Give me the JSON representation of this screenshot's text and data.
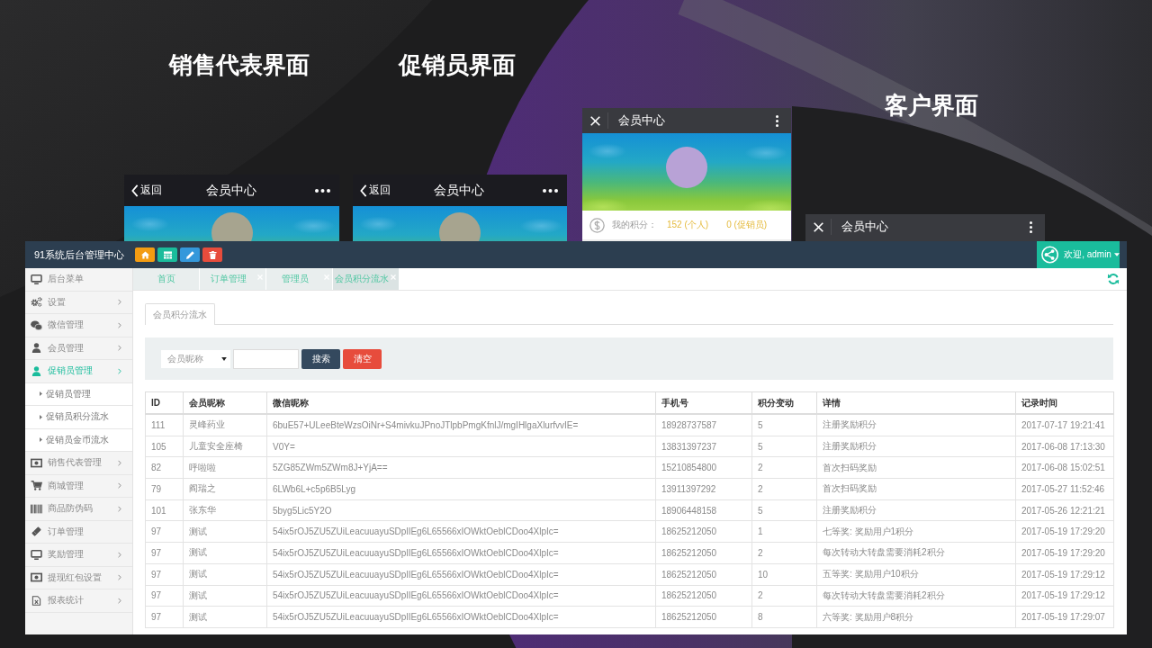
{
  "slide_headings": [
    "销售代表界面",
    "促销员界面",
    "客户界面"
  ],
  "phones": [
    {
      "kind": "ios",
      "back_label": "返回",
      "title": "会员中心",
      "banner": true
    },
    {
      "kind": "ios",
      "back_label": "返回",
      "title": "会员中心",
      "banner": true
    },
    {
      "kind": "android",
      "title": "会员中心",
      "banner": true,
      "points": {
        "label": "我的积分：",
        "personal": "152 (个人)",
        "promoter": "0 (促销员)"
      }
    },
    {
      "kind": "android",
      "title": "会员中心"
    }
  ],
  "admin": {
    "title": "91系统后台管理中心",
    "tool_buttons": [
      {
        "kind": "home"
      },
      {
        "kind": "grid"
      },
      {
        "kind": "edit"
      },
      {
        "kind": "delete"
      }
    ],
    "user_menu": "欢迎, admin",
    "sidebar": {
      "items": [
        {
          "label": "后台菜单",
          "selected": false,
          "chevron": false
        },
        {
          "label": "设置",
          "selected": false,
          "chevron": true
        },
        {
          "label": "微信管理",
          "selected": false,
          "chevron": true
        },
        {
          "label": "会员管理",
          "selected": false,
          "chevron": true
        },
        {
          "label": "促销员管理",
          "selected": true,
          "chevron": true,
          "children": [
            {
              "label": "促销员管理",
              "selected": false
            },
            {
              "label": "促销员积分流水",
              "selected": false
            },
            {
              "label": "促销员金币流水",
              "selected": false
            }
          ]
        },
        {
          "label": "销售代表管理",
          "selected": false,
          "chevron": true
        },
        {
          "label": "商城管理",
          "selected": false,
          "chevron": true
        },
        {
          "label": "商品防伪码",
          "selected": false,
          "chevron": true
        },
        {
          "label": "订单管理",
          "selected": false,
          "chevron": false
        },
        {
          "label": "奖励管理",
          "selected": false,
          "chevron": true
        },
        {
          "label": "提现红包设置",
          "selected": false,
          "chevron": true
        },
        {
          "label": "报表统计",
          "selected": false,
          "chevron": true
        }
      ]
    },
    "tabs": [
      {
        "label": "首页",
        "closable": false,
        "selected": false
      },
      {
        "label": "订单管理",
        "closable": true,
        "selected": false
      },
      {
        "label": "管理员",
        "closable": true,
        "selected": false
      },
      {
        "label": "会员积分流水",
        "closable": true,
        "selected": true
      }
    ],
    "panel_tabs": [
      {
        "label": "会员积分流水",
        "selected": true
      }
    ],
    "search": {
      "filter_field": "会员昵称",
      "buttons": [
        {
          "kind": "primary",
          "label": "搜索"
        },
        {
          "kind": "danger",
          "label": "清空"
        }
      ]
    },
    "table": {
      "columns": [
        "ID",
        "会员昵称",
        "微信昵称",
        "手机号",
        "积分变动",
        "详情",
        "记录时间"
      ],
      "rows": [
        [
          "111",
          "灵峰药业",
          "6buE57+ULeeBteWzsOiNr+S4mivkuJPnoJTlpbPmgKfnlJ/mgIHlgaXlurfvvIE=",
          "18928737587",
          "5",
          "注册奖励积分",
          "2017-07-17 19:21:41"
        ],
        [
          "105",
          "儿童安全座椅",
          "V0Y=",
          "13831397237",
          "5",
          "注册奖励积分",
          "2017-06-08 17:13:30"
        ],
        [
          "82",
          "呼啦啦",
          "5ZG85ZWm5ZWm8J+YjA==",
          "15210854800",
          "2",
          "首次扫码奖励",
          "2017-06-08 15:02:51"
        ],
        [
          "79",
          "阎瑞之",
          "6LWb6L+c5p6B5Lyg",
          "13911397292",
          "2",
          "首次扫码奖励",
          "2017-05-27 11:52:46"
        ],
        [
          "101",
          "张东华",
          "5byg5Lic5Y2O",
          "18906448158",
          "5",
          "注册奖励积分",
          "2017-05-26 12:21:21"
        ],
        [
          "97",
          "测试",
          "54ix5rOJ5ZU5ZUiLeacuuayuSDplIEg6L65566xIOWktOeblCDoo4XlpIc=",
          "18625212050",
          "1",
          "七等奖: 奖励用户1积分",
          "2017-05-19 17:29:20"
        ],
        [
          "97",
          "测试",
          "54ix5rOJ5ZU5ZUiLeacuuayuSDplIEg6L65566xIOWktOeblCDoo4XlpIc=",
          "18625212050",
          "2",
          "每次转动大转盘需要消耗2积分",
          "2017-05-19 17:29:20"
        ],
        [
          "97",
          "测试",
          "54ix5rOJ5ZU5ZUiLeacuuayuSDplIEg6L65566xIOWktOeblCDoo4XlpIc=",
          "18625212050",
          "10",
          "五等奖: 奖励用户10积分",
          "2017-05-19 17:29:12"
        ],
        [
          "97",
          "测试",
          "54ix5rOJ5ZU5ZUiLeacuuayuSDplIEg6L65566xIOWktOeblCDoo4XlpIc=",
          "18625212050",
          "2",
          "每次转动大转盘需要消耗2积分",
          "2017-05-19 17:29:12"
        ],
        [
          "97",
          "测试",
          "54ix5rOJ5ZU5ZUiLeacuuayuSDplIEg6L65566xIOWktOeblCDoo4XlpIc=",
          "18625212050",
          "8",
          "六等奖: 奖励用户8积分",
          "2017-05-19 17:29:07"
        ]
      ]
    }
  }
}
